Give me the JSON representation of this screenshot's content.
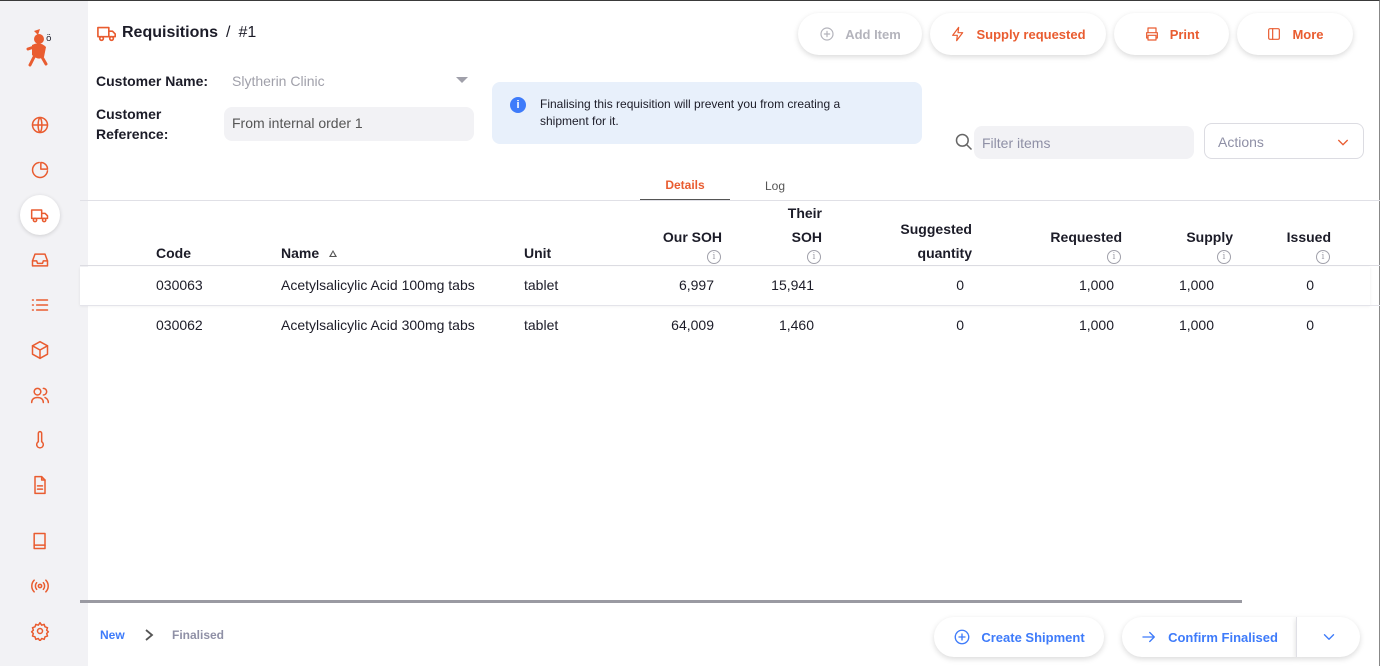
{
  "colors": {
    "accent": "#e95c30",
    "primary_blue": "#3e7bfa",
    "sidebar_bg": "#f2f2f5",
    "info_bg": "#e8f0fb"
  },
  "sidebar": {
    "items": [
      {
        "icon": "globe-icon"
      },
      {
        "icon": "pie-chart-icon"
      },
      {
        "icon": "truck-icon",
        "active": true
      },
      {
        "icon": "inbox-icon"
      },
      {
        "icon": "list-icon"
      },
      {
        "icon": "package-icon"
      },
      {
        "icon": "users-icon"
      },
      {
        "icon": "thermometer-icon"
      },
      {
        "icon": "file-text-icon"
      },
      {
        "icon": "book-icon"
      },
      {
        "icon": "radio-icon"
      },
      {
        "icon": "gear-icon"
      }
    ]
  },
  "header": {
    "section": "Requisitions",
    "separator": "/",
    "number": "#1",
    "buttons": {
      "add_item": "Add Item",
      "supply_requested": "Supply requested",
      "print": "Print",
      "more": "More"
    }
  },
  "form": {
    "customer_name_label": "Customer Name:",
    "customer_name_value": "Slytherin Clinic",
    "customer_reference_label_1": "Customer",
    "customer_reference_label_2": "Reference:",
    "customer_reference_value": "From internal order 1",
    "info_line_1": "Finalising this requisition will prevent you from creating a",
    "info_line_2": "shipment for it."
  },
  "toolbar": {
    "filter_placeholder": "Filter items",
    "actions_label": "Actions"
  },
  "tabs": {
    "details": "Details",
    "log": "Log"
  },
  "table": {
    "headers": {
      "code": "Code",
      "name": "Name",
      "unit": "Unit",
      "our_soh": "Our SOH",
      "their_soh_1": "Their",
      "their_soh_2": "SOH",
      "suggested_1": "Suggested",
      "suggested_2": "quantity",
      "requested": "Requested",
      "supply": "Supply",
      "issued": "Issued"
    },
    "rows": [
      {
        "code": "030063",
        "name": "Acetylsalicylic Acid 100mg tabs",
        "unit": "tablet",
        "our_soh": "6,997",
        "their_soh": "15,941",
        "suggested": "0",
        "requested": "1,000",
        "supply": "1,000",
        "issued": "0"
      },
      {
        "code": "030062",
        "name": "Acetylsalicylic Acid 300mg tabs",
        "unit": "tablet",
        "our_soh": "64,009",
        "their_soh": "1,460",
        "suggested": "0",
        "requested": "1,000",
        "supply": "1,000",
        "issued": "0"
      }
    ]
  },
  "footer": {
    "status_new": "New",
    "status_finalised": "Finalised",
    "create_shipment": "Create Shipment",
    "confirm_finalised": "Confirm Finalised"
  }
}
